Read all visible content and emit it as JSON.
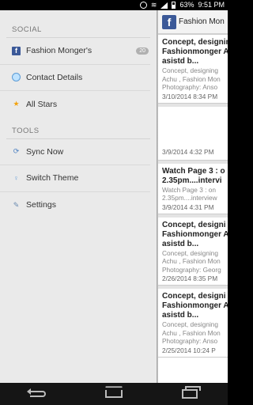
{
  "status_bar": {
    "battery": "63%",
    "time": "9:51 PM"
  },
  "drawer": {
    "sections": [
      {
        "header": "SOCIAL",
        "items": [
          {
            "label": "Fashion Monger's",
            "icon": "facebook-icon",
            "badge": "20"
          },
          {
            "label": "Contact Details",
            "icon": "globe-icon"
          },
          {
            "label": "All Stars",
            "icon": "star-icon"
          }
        ]
      },
      {
        "header": "TOOLS",
        "items": [
          {
            "label": "Sync Now",
            "icon": "sync-icon"
          },
          {
            "label": "Switch Theme",
            "icon": "bulb-icon"
          },
          {
            "label": "Settings",
            "icon": "wrench-icon"
          }
        ]
      }
    ]
  },
  "action_bar": {
    "title": "Fashion Mon"
  },
  "feed": [
    {
      "title_lines": [
        "Concept, designin",
        "Fashionmonger A",
        "asistd b..."
      ],
      "body_lines": [
        "Concept, designing",
        "Achu , Fashion Mon",
        "Photography: Anso"
      ],
      "time": "3/10/2014 8:34 PM"
    },
    {
      "title_lines": [],
      "body_lines": [],
      "time": "3/9/2014 4:32 PM"
    },
    {
      "title_lines": [
        "Watch Page 3 : o",
        "2.35pm....intervi"
      ],
      "body_lines": [
        "Watch Page 3 : on",
        "2.35pm....interview"
      ],
      "time": "3/9/2014 4:31 PM"
    },
    {
      "title_lines": [
        "Concept, designi",
        "Fashionmonger A",
        "asistd b..."
      ],
      "body_lines": [
        "Concept, designing",
        "Achu , Fashion Mon",
        "Photography: Georg"
      ],
      "time": "2/26/2014 8:35 PM"
    },
    {
      "title_lines": [
        "Concept, designi",
        "Fashionmonger A",
        "asistd b..."
      ],
      "body_lines": [
        "Concept, designing",
        "Achu , Fashion Mon",
        "Photography: Anso"
      ],
      "time": "2/25/2014 10:24 P"
    }
  ],
  "nav": {
    "back": "back-icon",
    "home": "home-icon",
    "recents": "recents-icon"
  },
  "colors": {
    "facebook_blue": "#3b5998",
    "star": "#f2a30f"
  }
}
